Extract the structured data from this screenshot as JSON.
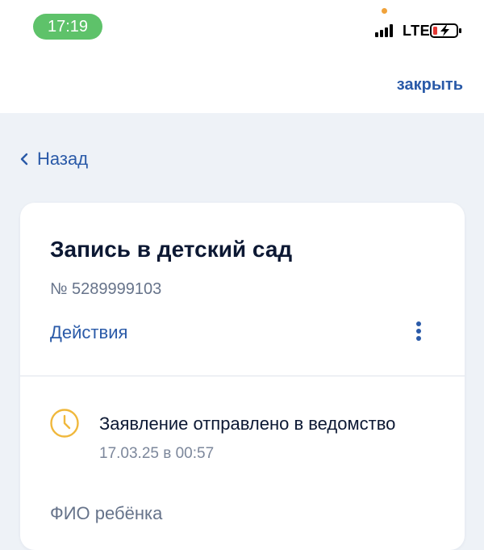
{
  "status_bar": {
    "time": "17:19",
    "network": "LTE",
    "colors": {
      "time_pill": "#5ec26a",
      "privacy_dot": "#f0a23a",
      "battery_low": "#e53935"
    }
  },
  "header": {
    "close_label": "закрыть"
  },
  "nav": {
    "back_label": "Назад"
  },
  "card": {
    "title": "Запись в детский сад",
    "number": "№ 5289999103",
    "actions_label": "Действия",
    "status": {
      "icon": "clock-icon",
      "text": "Заявление отправлено в ведомство",
      "date": "17.03.25 в 00:57"
    },
    "field_label": "ФИО ребёнка"
  },
  "colors": {
    "accent": "#2a5aa8",
    "title": "#0c1833",
    "muted": "#66738a",
    "background": "#eef2f7",
    "status_icon": "#f0b83c"
  }
}
